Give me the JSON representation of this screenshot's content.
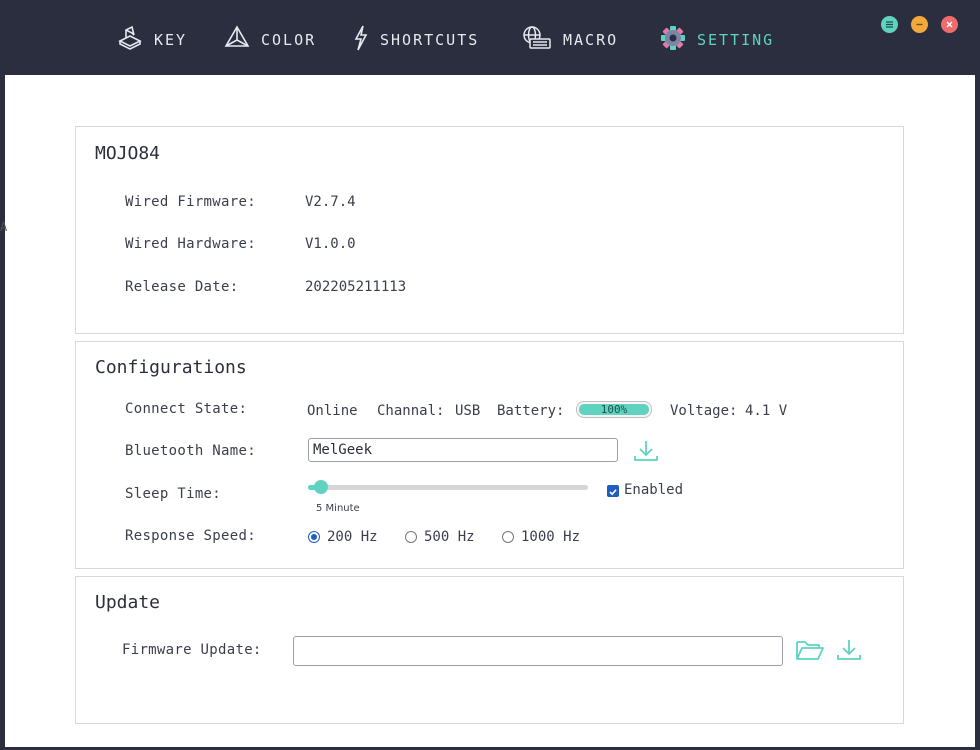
{
  "nav": {
    "items": [
      {
        "label": "KEY",
        "icon": "keycap-icon"
      },
      {
        "label": "COLOR",
        "icon": "prism-icon"
      },
      {
        "label": "SHORTCUTS",
        "icon": "lightning-icon"
      },
      {
        "label": "MACRO",
        "icon": "keyboard-globe-icon"
      },
      {
        "label": "SETTING",
        "icon": "gear-icon",
        "active": true
      }
    ],
    "active_color": "#5fd3c0"
  },
  "window_controls": {
    "menu_color": "#5fd3c0",
    "minimize_color": "#f2a93b",
    "close_color": "#f06c6c"
  },
  "device": {
    "name": "MOJO84",
    "rows": [
      {
        "label": "Wired Firmware:",
        "value": "V2.7.4"
      },
      {
        "label": "Wired Hardware:",
        "value": "V1.0.0"
      },
      {
        "label": "Release Date:",
        "value": "202205211113"
      }
    ]
  },
  "config": {
    "title": "Configurations",
    "connect_state_label": "Connect State:",
    "status": "Online",
    "channel_label": "Channal:",
    "channel_value": "USB",
    "battery_label": "Battery:",
    "battery_text": "100%",
    "battery_level": 1.0,
    "voltage_label": "Voltage:",
    "voltage_value": "4.1 V",
    "bluetooth_label": "Bluetooth Name:",
    "bluetooth_value": "MelGeek",
    "sleep_label": "Sleep Time:",
    "sleep_caption": "5 Minute",
    "sleep_level": 0.045,
    "enabled_label": "Enabled",
    "enabled_checked": true,
    "response_label": "Response Speed:",
    "response_options": [
      "200 Hz",
      "500 Hz",
      "1000 Hz"
    ],
    "response_selected": "200 Hz"
  },
  "update": {
    "title": "Update",
    "firmware_label": "Firmware Update:",
    "firmware_value": ""
  },
  "edge_glyph": "A"
}
